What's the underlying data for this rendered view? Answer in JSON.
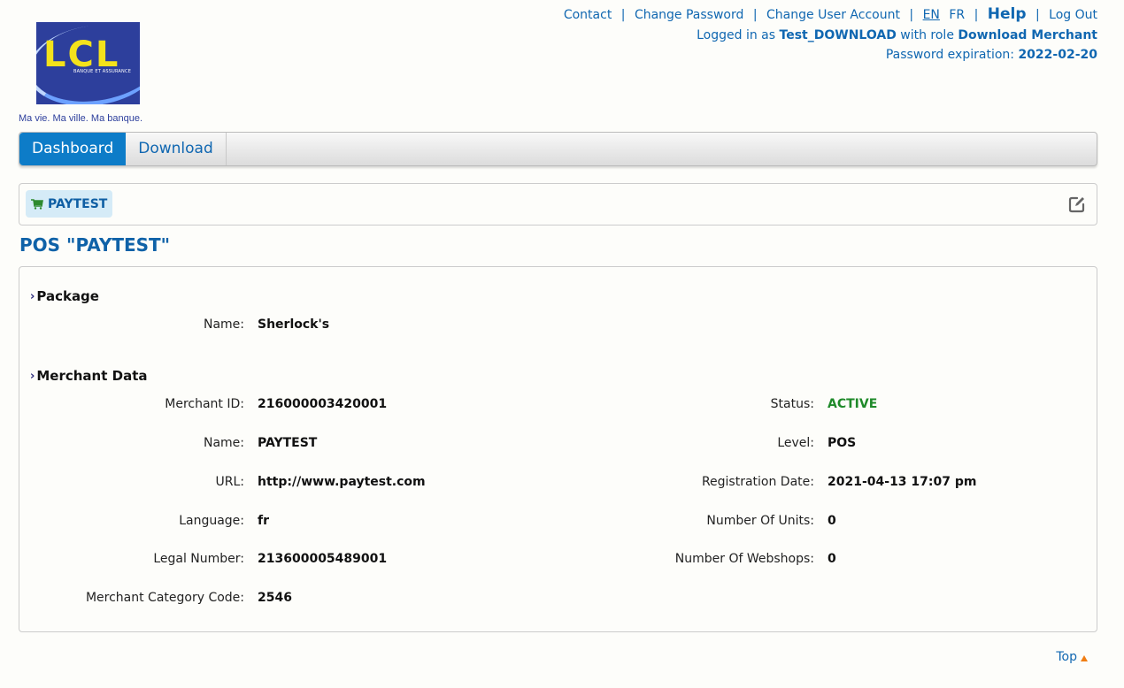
{
  "branding": {
    "logo_text": "LCL",
    "logo_subtext": "BANQUE ET ASSURANCE",
    "tagline": "Ma vie. Ma ville. Ma banque."
  },
  "header": {
    "links": {
      "contact": "Contact",
      "change_password": "Change Password",
      "change_user_account": "Change User Account",
      "lang_en": "EN",
      "lang_fr": "FR",
      "help": "Help",
      "logout": "Log Out"
    },
    "separator": "|",
    "logged_in_prefix": "Logged in as",
    "username": "Test_DOWNLOAD",
    "role_prefix": "with role",
    "role": "Download Merchant",
    "password_expiration_label": "Password expiration:",
    "password_expiration_date": "2022-02-20"
  },
  "nav": {
    "tabs": [
      {
        "label": "Dashboard",
        "active": true
      },
      {
        "label": "Download",
        "active": false
      }
    ]
  },
  "pos_bar": {
    "chip_label": "PAYTEST",
    "chip_icon": "cart-icon",
    "edit_icon": "edit-icon"
  },
  "page_title": "POS \"PAYTEST\"",
  "package": {
    "heading": "Package",
    "fields": [
      {
        "label": "Name:",
        "value": "Sherlock's"
      }
    ]
  },
  "merchant_data": {
    "heading": "Merchant Data",
    "left": [
      {
        "label": "Merchant ID:",
        "value": "216000003420001"
      },
      {
        "label": "Name:",
        "value": "PAYTEST"
      },
      {
        "label": "URL:",
        "value": "http://www.paytest.com"
      },
      {
        "label": "Language:",
        "value": "fr"
      },
      {
        "label": "Legal Number:",
        "value": "213600005489001"
      },
      {
        "label": "Merchant Category Code:",
        "value": "2546"
      }
    ],
    "right": [
      {
        "label": "Status:",
        "value": "ACTIVE"
      },
      {
        "label": "Level:",
        "value": "POS"
      },
      {
        "label": "Registration Date:",
        "value": "2021-04-13 17:07 pm"
      },
      {
        "label": "Number Of Units:",
        "value": "0"
      },
      {
        "label": "Number Of Webshops:",
        "value": "0"
      }
    ]
  },
  "footer": {
    "top_link": "Top"
  },
  "colors": {
    "brand_blue": "#0d7cc8",
    "link_blue": "#1067b1",
    "status_active": "#1f8a2a",
    "top_arrow": "#f07d12"
  }
}
